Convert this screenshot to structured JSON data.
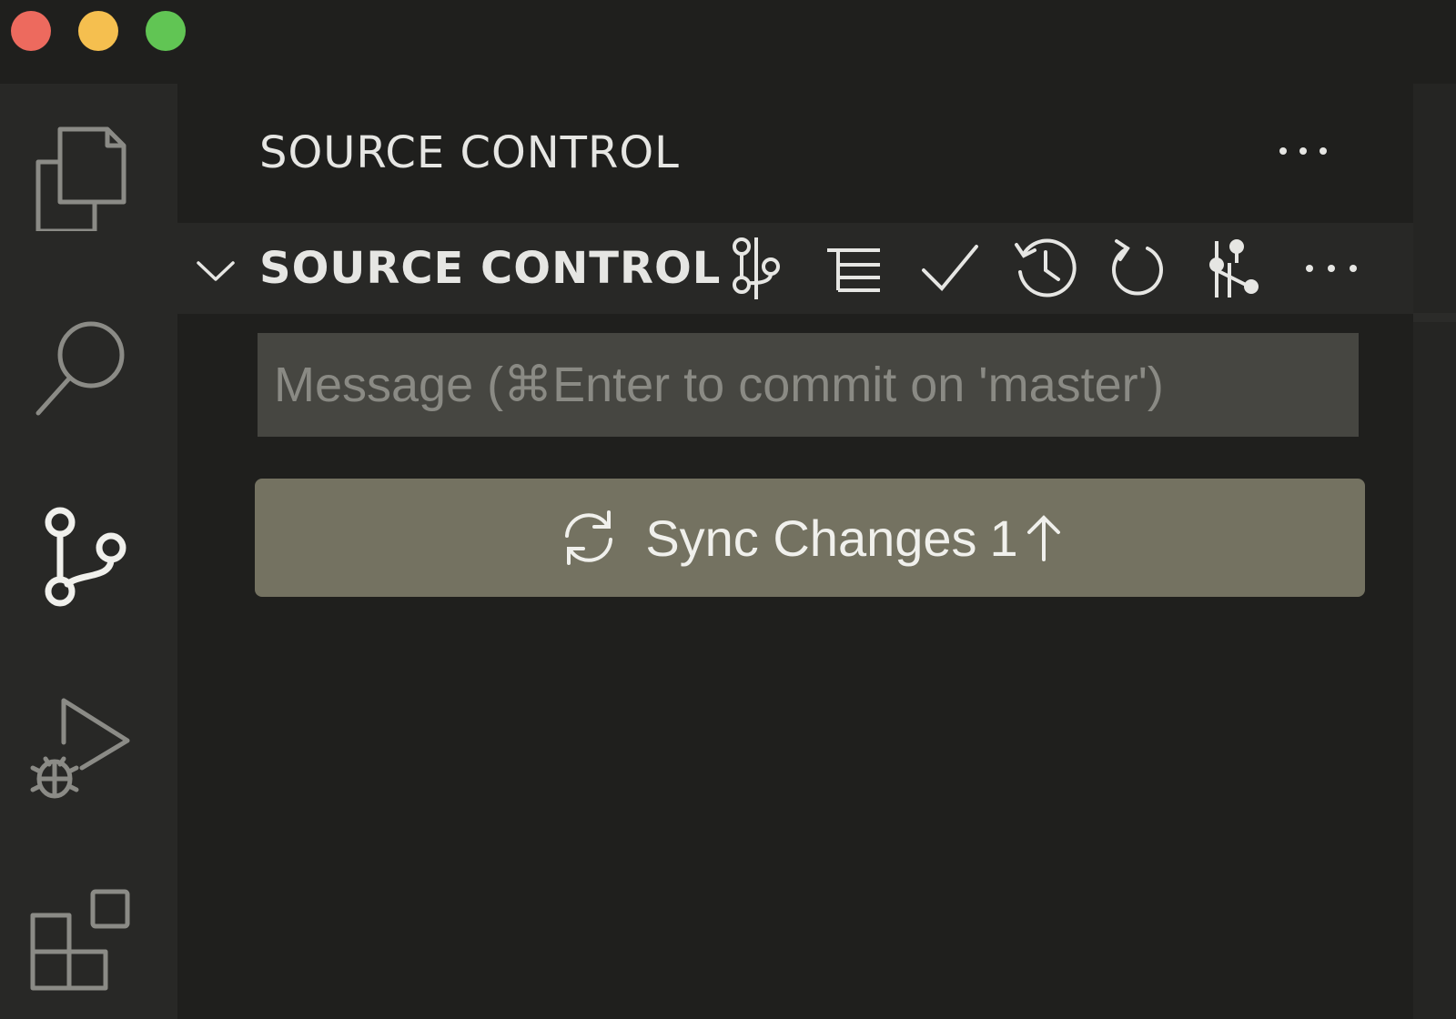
{
  "window": {
    "traffic_lights": {
      "close_color": "#ed6a5e",
      "minimize_color": "#f5bf4f",
      "maximize_color": "#61c554"
    }
  },
  "activity_bar": {
    "items": [
      {
        "name": "explorer",
        "icon": "files-icon",
        "active": false
      },
      {
        "name": "search",
        "icon": "search-icon",
        "active": false
      },
      {
        "name": "source-control",
        "icon": "source-control-icon",
        "active": true
      },
      {
        "name": "run-and-debug",
        "icon": "run-debug-icon",
        "active": false
      },
      {
        "name": "extensions",
        "icon": "extensions-icon",
        "active": false
      }
    ]
  },
  "panel": {
    "title": "SOURCE CONTROL",
    "more_icon": "ellipsis-icon"
  },
  "section": {
    "title": "SOURCE CONTROL",
    "expanded": true,
    "toolbar": [
      {
        "name": "graph",
        "icon": "git-graph-icon"
      },
      {
        "name": "view-as-tree",
        "icon": "tree-list-icon"
      },
      {
        "name": "commit",
        "icon": "check-icon"
      },
      {
        "name": "history",
        "icon": "history-icon"
      },
      {
        "name": "refresh",
        "icon": "refresh-icon"
      },
      {
        "name": "branch-actions",
        "icon": "git-branch-actions-icon"
      },
      {
        "name": "more-actions",
        "icon": "ellipsis-icon"
      }
    ]
  },
  "commit": {
    "placeholder": "Message (⌘Enter to commit on 'master')",
    "value": ""
  },
  "sync": {
    "label": "Sync Changes",
    "count": "1",
    "icon": "sync-icon",
    "arrow_icon": "arrow-up-icon"
  },
  "colors": {
    "background": "#1f1f1d",
    "activity_bar": "#282826",
    "section_header": "#282826",
    "input_background": "#464641",
    "button_background": "#747261",
    "text": "#e6e6e3",
    "placeholder": "#8a8a84"
  }
}
